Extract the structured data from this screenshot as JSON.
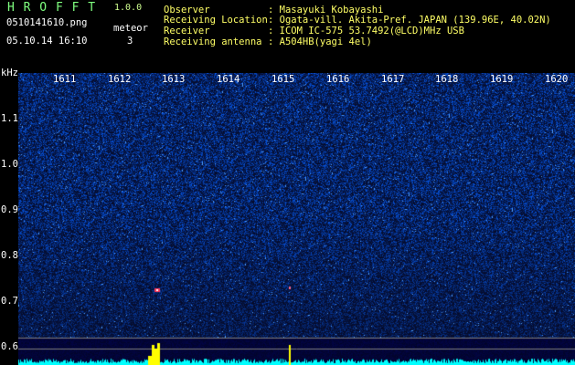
{
  "app": {
    "title": "H R O F F T",
    "version": "1.0.0"
  },
  "file": {
    "name": "0510141610.png",
    "datetime": "05.10.14 16:10"
  },
  "meteor": {
    "label": "meteor",
    "count": "3"
  },
  "info": {
    "observer_label": "Observer",
    "observer_value": ": Masayuki Kobayashi",
    "location_label": "Receiving Location",
    "location_value": ": Ogata-vill. Akita-Pref. JAPAN (139.96E, 40.02N)",
    "receiver_label": "Receiver",
    "receiver_value": ": ICOM IC-575 53.7492(@LCD)MHz USB",
    "antenna_label": "Receiving antenna",
    "antenna_value": ": A504HB(yagi 4el)"
  },
  "axis": {
    "unit": "kHz",
    "y_ticks": [
      "1.1",
      "1.0",
      "0.9",
      "0.8",
      "0.7",
      "0.6"
    ],
    "time_marks": [
      "1611",
      "1612",
      "1613",
      "1614",
      "1615",
      "1616",
      "1617",
      "1618",
      "1619",
      "1620"
    ]
  },
  "colors": {
    "background": "#000000",
    "noise_dark": "#061a78",
    "noise_bright": "#3b6fff",
    "echo": "#ff3355",
    "baseline": "#00ffff",
    "spike": "#ffff00",
    "label_green": "#7fff7f",
    "label_yellow": "#ffff66"
  }
}
